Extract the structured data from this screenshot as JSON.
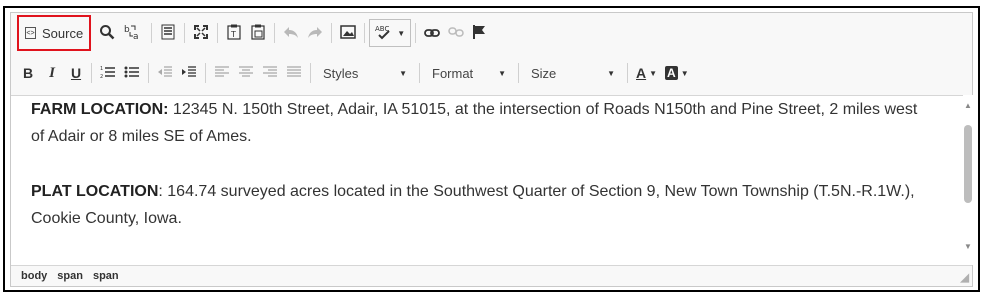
{
  "toolbar": {
    "source_label": "Source",
    "styles_label": "Styles",
    "format_label": "Format",
    "size_label": "Size",
    "bold_label": "B",
    "italic_label": "I",
    "underline_label": "U",
    "text_color_label": "A",
    "bg_color_label": "A",
    "spell_label": "ABC"
  },
  "content": {
    "p1_label": "FARM LOCATION:",
    "p1_text": " 12345 N. 150th Street, Adair, IA 51015, at the intersection of Roads N150th and Pine Street, 2 miles west of Adair or 8 miles SE of Ames.",
    "p2_label": "PLAT LOCATION",
    "p2_text": ": 164.74 surveyed acres located in the Southwest Quarter of Section 9, New Town Township (T.5N.-R.1W.), Cookie County, Iowa."
  },
  "statusbar": {
    "path": [
      "body",
      "span",
      "span"
    ]
  },
  "colors": {
    "highlight_border": "#e0131d",
    "toolbar_bg": "#f8f8f8"
  }
}
